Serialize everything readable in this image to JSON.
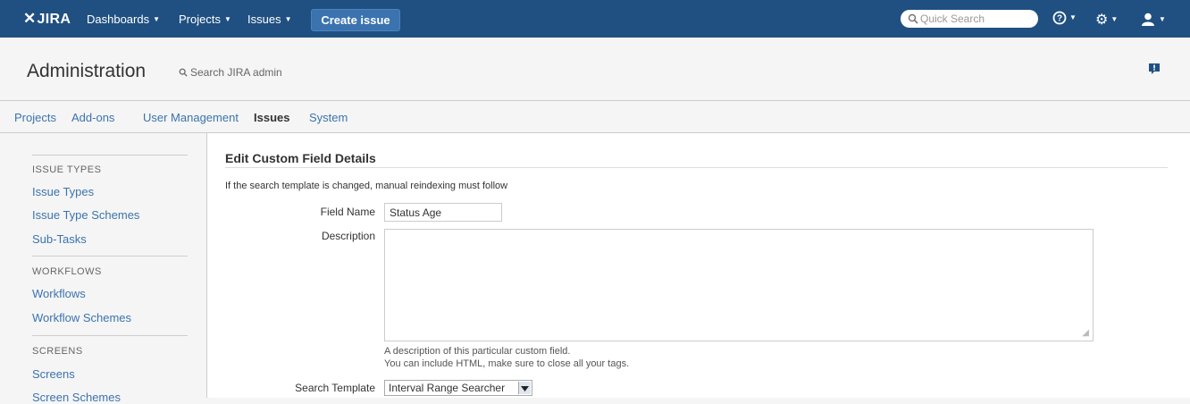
{
  "topnav": {
    "logo": "JIRA",
    "menus": [
      "Dashboards",
      "Projects",
      "Issues"
    ],
    "create_label": "Create issue",
    "quick_search_placeholder": "Quick Search"
  },
  "admin": {
    "title": "Administration",
    "search_label": "Search JIRA admin"
  },
  "tabs": [
    "Projects",
    "Add-ons",
    "User Management",
    "Issues",
    "System"
  ],
  "active_tab": "Issues",
  "sidebar": {
    "issue_types_heading": "ISSUE TYPES",
    "issue_types": [
      "Issue Types",
      "Issue Type Schemes",
      "Sub-Tasks"
    ],
    "workflows_heading": "WORKFLOWS",
    "workflows": [
      "Workflows",
      "Workflow Schemes"
    ],
    "screens_heading": "SCREENS",
    "screens": [
      "Screens",
      "Screen Schemes"
    ]
  },
  "form": {
    "title": "Edit Custom Field Details",
    "note": "If the search template is changed, manual reindexing must follow",
    "field_name_label": "Field Name",
    "field_name_value": "Status Age",
    "description_label": "Description",
    "description_help_1": "A description of this particular custom field.",
    "description_help_2": "You can include HTML, make sure to close all your tags.",
    "search_template_label": "Search Template",
    "search_template_value": "Interval Range Searcher"
  }
}
